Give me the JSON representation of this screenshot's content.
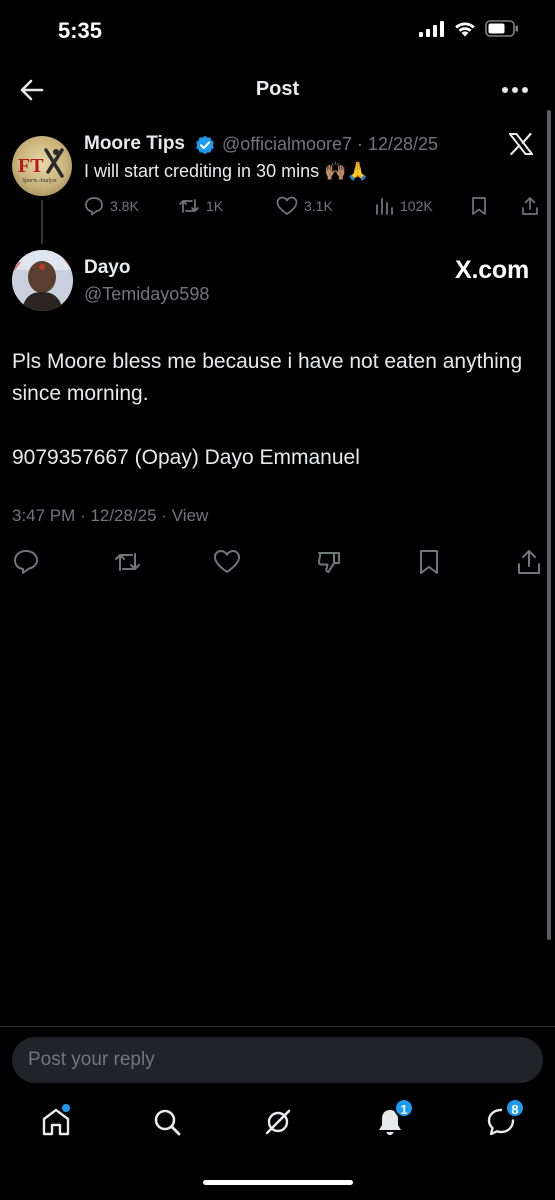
{
  "status_bar": {
    "time": "5:35"
  },
  "header": {
    "title": "Post"
  },
  "quoted_post": {
    "author_name": "Moore Tips",
    "handle_date": "@officialmoore7 · 12/28/25",
    "text": "I will start crediting in 30 mins 🙌🏽🙏",
    "metrics": {
      "replies": "3.8K",
      "reposts": "1K",
      "likes": "3.1K",
      "views": "102K"
    },
    "avatar_text": {
      "logo": "FT",
      "tagline": "Sports Analyst"
    }
  },
  "post": {
    "author_name": "Dayo",
    "handle": "@Temidayo598",
    "watermark": "X.com",
    "paragraph_1": "Pls Moore bless me because i have not eaten anything since morning.",
    "paragraph_2": "9079357667 (Opay) Dayo Emmanuel",
    "meta": "3:47 PM · 12/28/25 · View"
  },
  "reply": {
    "placeholder": "Post your reply"
  },
  "nav": {
    "notifications_badge": "1",
    "messages_badge": "8"
  },
  "colors": {
    "accent": "#1d9bf0",
    "muted": "#71767b",
    "background": "#000000"
  }
}
